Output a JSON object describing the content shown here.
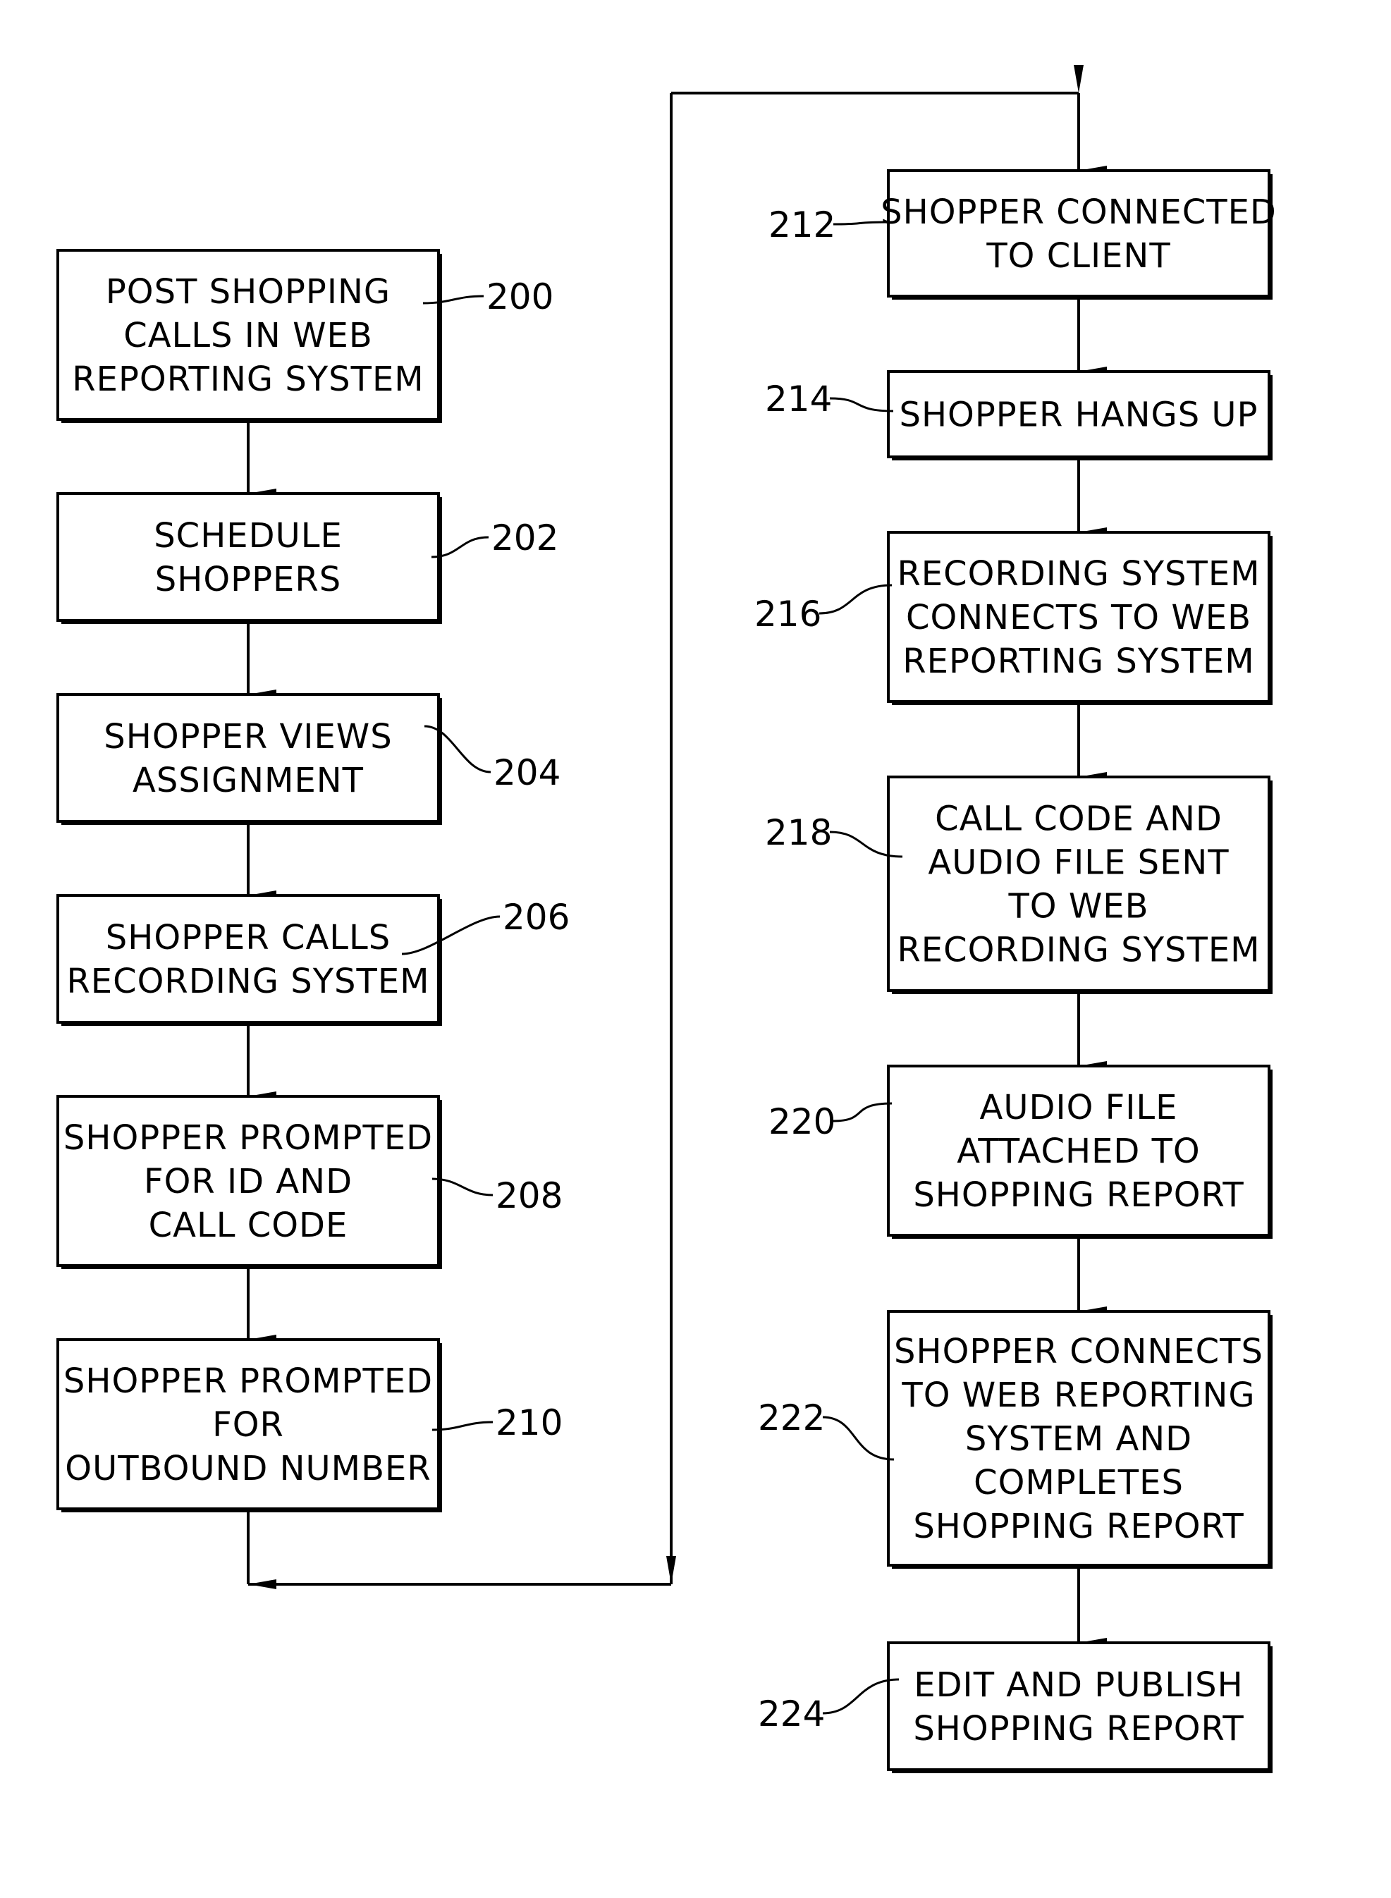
{
  "figure": {
    "type": "flowchart",
    "colors": {
      "line": "#000000",
      "background": "#ffffff"
    }
  },
  "steps": [
    {
      "id": "200",
      "ref": "200",
      "lines": [
        "POST SHOPPING",
        "CALLS IN WEB",
        "REPORTING SYSTEM"
      ]
    },
    {
      "id": "202",
      "ref": "202",
      "lines": [
        "SCHEDULE",
        "SHOPPERS"
      ]
    },
    {
      "id": "204",
      "ref": "204",
      "lines": [
        "SHOPPER VIEWS",
        "ASSIGNMENT"
      ]
    },
    {
      "id": "206",
      "ref": "206",
      "lines": [
        "SHOPPER CALLS",
        "RECORDING SYSTEM"
      ]
    },
    {
      "id": "208",
      "ref": "208",
      "lines": [
        "SHOPPER PROMPTED",
        "FOR ID AND",
        "CALL CODE"
      ]
    },
    {
      "id": "210",
      "ref": "210",
      "lines": [
        "SHOPPER PROMPTED",
        "FOR",
        "OUTBOUND NUMBER"
      ]
    },
    {
      "id": "212",
      "ref": "212",
      "lines": [
        "SHOPPER CONNECTED",
        "TO CLIENT"
      ]
    },
    {
      "id": "214",
      "ref": "214",
      "lines": [
        "SHOPPER HANGS UP"
      ]
    },
    {
      "id": "216",
      "ref": "216",
      "lines": [
        "RECORDING SYSTEM",
        "CONNECTS TO WEB",
        "REPORTING SYSTEM"
      ]
    },
    {
      "id": "218",
      "ref": "218",
      "lines": [
        "CALL CODE AND",
        "AUDIO FILE SENT",
        "TO WEB",
        "RECORDING SYSTEM"
      ]
    },
    {
      "id": "220",
      "ref": "220",
      "lines": [
        "AUDIO FILE",
        "ATTACHED TO",
        "SHOPPING REPORT"
      ]
    },
    {
      "id": "222",
      "ref": "222",
      "lines": [
        "SHOPPER CONNECTS",
        "TO WEB REPORTING",
        "SYSTEM AND",
        "COMPLETES",
        "SHOPPING REPORT"
      ]
    },
    {
      "id": "224",
      "ref": "224",
      "lines": [
        "EDIT AND PUBLISH",
        "SHOPPING REPORT"
      ]
    }
  ],
  "flow": [
    "200",
    "202",
    "204",
    "206",
    "208",
    "210",
    "212",
    "214",
    "216",
    "218",
    "220",
    "222",
    "224"
  ]
}
